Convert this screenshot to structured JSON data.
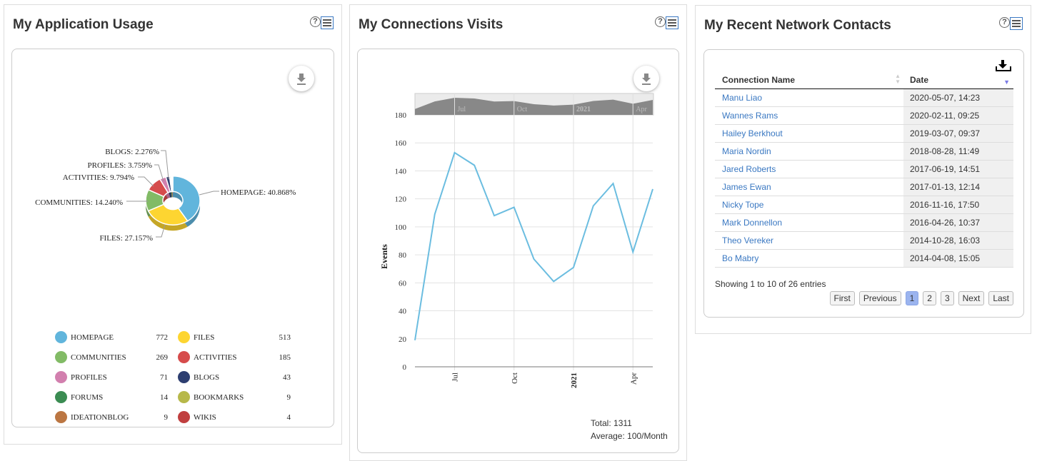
{
  "usage": {
    "title": "My Application Usage",
    "slices": [
      {
        "name": "HOMEPAGE",
        "count": 772,
        "pct": "HOMEPAGE: 40.868%",
        "color": "#61b5dc"
      },
      {
        "name": "FILES",
        "count": 513,
        "pct": "FILES: 27.157%",
        "color": "#fdd531"
      },
      {
        "name": "COMMUNITIES",
        "count": 269,
        "pct": "COMMUNITIES: 14.240%",
        "color": "#82bb66"
      },
      {
        "name": "ACTIVITIES",
        "count": 185,
        "pct": "ACTIVITIES: 9.794%",
        "color": "#d64c4c"
      },
      {
        "name": "PROFILES",
        "count": 71,
        "pct": "PROFILES: 3.759%",
        "color": "#d27fae"
      },
      {
        "name": "BLOGS",
        "count": 43,
        "pct": "BLOGS: 2.276%",
        "color": "#2d3e70"
      },
      {
        "name": "FORUMS",
        "count": 14,
        "color": "#3b8c52"
      },
      {
        "name": "BOOKMARKS",
        "count": 9,
        "color": "#b7b84a"
      },
      {
        "name": "IDEATIONBLOG",
        "count": 9,
        "color": "#bb7642"
      },
      {
        "name": "WIKIS",
        "count": 4,
        "color": "#c03f3f"
      }
    ]
  },
  "visits": {
    "title": "My Connections Visits",
    "total": "Total: 1311",
    "average": "Average: 100/Month",
    "chart_data": {
      "type": "line",
      "ylabel": "Events",
      "ylim": [
        0,
        180
      ],
      "yticks": [
        "0",
        "20",
        "40",
        "60",
        "80",
        "100",
        "120",
        "140",
        "160",
        "180"
      ],
      "x": [
        "2020-05",
        "2020-06",
        "2020-07",
        "2020-08",
        "2020-09",
        "2020-10",
        "2020-11",
        "2020-12",
        "2021-01",
        "2021-02",
        "2021-03",
        "2021-04",
        "2021-05"
      ],
      "values": [
        19,
        109,
        153,
        144,
        108,
        114,
        77,
        61,
        71,
        115,
        131,
        82,
        127
      ],
      "xticks": [
        {
          "label": "Jul",
          "at": "2020-07"
        },
        {
          "label": "Oct",
          "at": "2020-10"
        },
        {
          "label": "2021",
          "at": "2021-01"
        },
        {
          "label": "Apr",
          "at": "2021-04"
        }
      ],
      "color": "#6bbde0"
    }
  },
  "contacts": {
    "title": "My Recent Network Contacts",
    "col_name": "Connection Name",
    "col_date": "Date",
    "rows": [
      {
        "name": "Manu Liao",
        "date": "2020-05-07, 14:23"
      },
      {
        "name": "Wannes Rams",
        "date": "2020-02-11, 09:25"
      },
      {
        "name": "Hailey Berkhout",
        "date": "2019-03-07, 09:37"
      },
      {
        "name": "Maria Nordin",
        "date": "2018-08-28, 11:49"
      },
      {
        "name": "Jared Roberts",
        "date": "2017-06-19, 14:51"
      },
      {
        "name": "James Ewan",
        "date": "2017-01-13, 12:14"
      },
      {
        "name": "Nicky Tope",
        "date": "2016-11-16, 17:50"
      },
      {
        "name": "Mark Donnellon",
        "date": "2016-04-26, 10:37"
      },
      {
        "name": "Theo Vereker",
        "date": "2014-10-28, 16:03"
      },
      {
        "name": "Bo Mabry",
        "date": "2014-04-08, 15:05"
      }
    ],
    "info": "Showing 1 to 10 of 26 entries",
    "pager": {
      "first": "First",
      "previous": "Previous",
      "pages": [
        "1",
        "2",
        "3"
      ],
      "current": "1",
      "next": "Next",
      "last": "Last"
    }
  }
}
